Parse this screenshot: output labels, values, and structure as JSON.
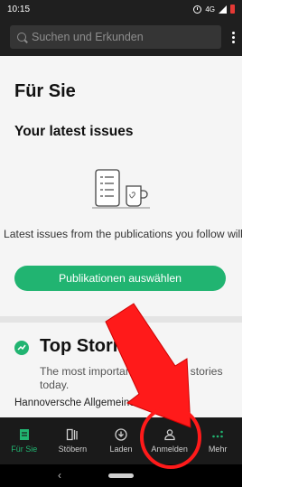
{
  "status_bar": {
    "time": "10:15",
    "network": "4G"
  },
  "search": {
    "placeholder": "Suchen und Erkunden"
  },
  "page": {
    "title": "Für Sie",
    "section_title": "Your latest issues",
    "empty_message": "Latest issues from the publications you follow will show up here",
    "button_label": "Publikationen auswählen",
    "top_stories_title": "Top Stories",
    "top_stories_subtitle": "The most important front page stories today.",
    "first_source": "Hannoversche Allgemeine"
  },
  "nav": {
    "items": [
      {
        "label": "Für Sie",
        "icon": "book-icon",
        "active": true
      },
      {
        "label": "Stöbern",
        "icon": "browse-icon",
        "active": false
      },
      {
        "label": "Laden",
        "icon": "download-icon",
        "active": false
      },
      {
        "label": "Anmelden",
        "icon": "person-icon",
        "active": false
      },
      {
        "label": "Mehr",
        "icon": "more-dots-icon",
        "active": false
      }
    ]
  },
  "colors": {
    "accent": "#21b471",
    "bar": "#1f1f1f",
    "annotation": "#ff1a1a"
  }
}
